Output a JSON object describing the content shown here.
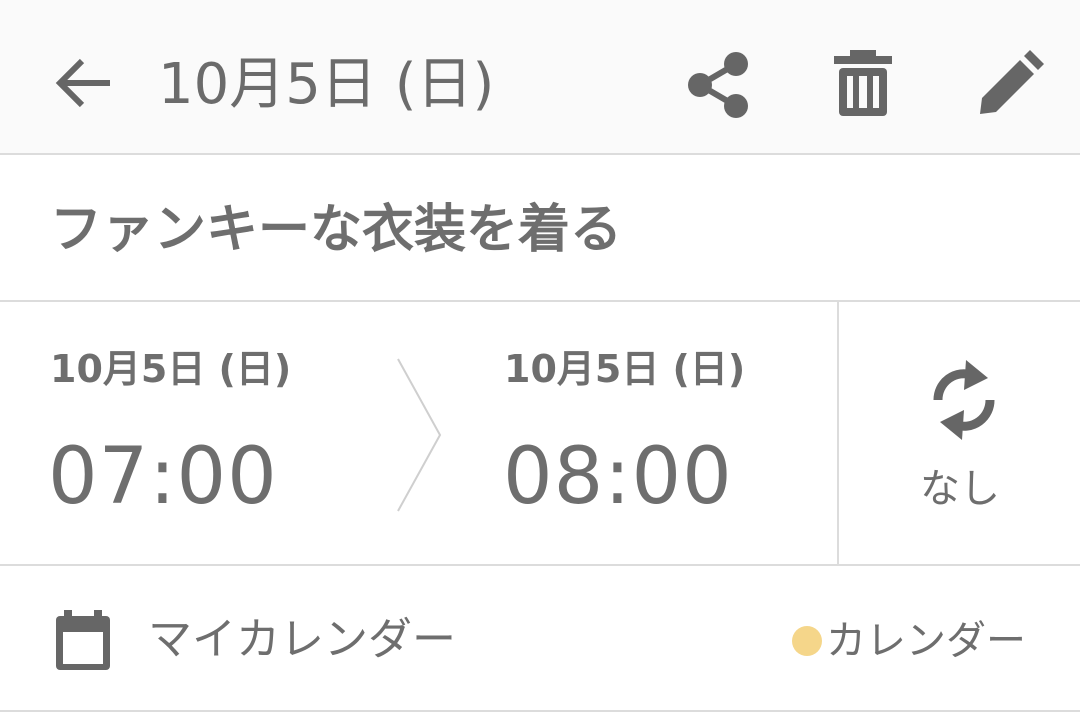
{
  "header": {
    "title": "10月5日 (日)",
    "back_icon": "arrow-left-icon",
    "actions": [
      "share-icon",
      "trash-icon",
      "pencil-icon"
    ]
  },
  "event": {
    "title": "ファンキーな衣装を着る"
  },
  "schedule": {
    "start_date": "10月5日 (日)",
    "start_time": "07:00",
    "end_date": "10月5日 (日)",
    "end_time": "08:00"
  },
  "repeat": {
    "icon": "sync-icon",
    "label": "なし"
  },
  "calendar": {
    "icon": "calendar-icon",
    "name": "マイカレンダー",
    "type_label": "カレンダー",
    "color": "#f5d68a"
  },
  "colors": {
    "icon": "#666666",
    "divider": "#dcdcdc",
    "header_bg": "#fafafa"
  }
}
